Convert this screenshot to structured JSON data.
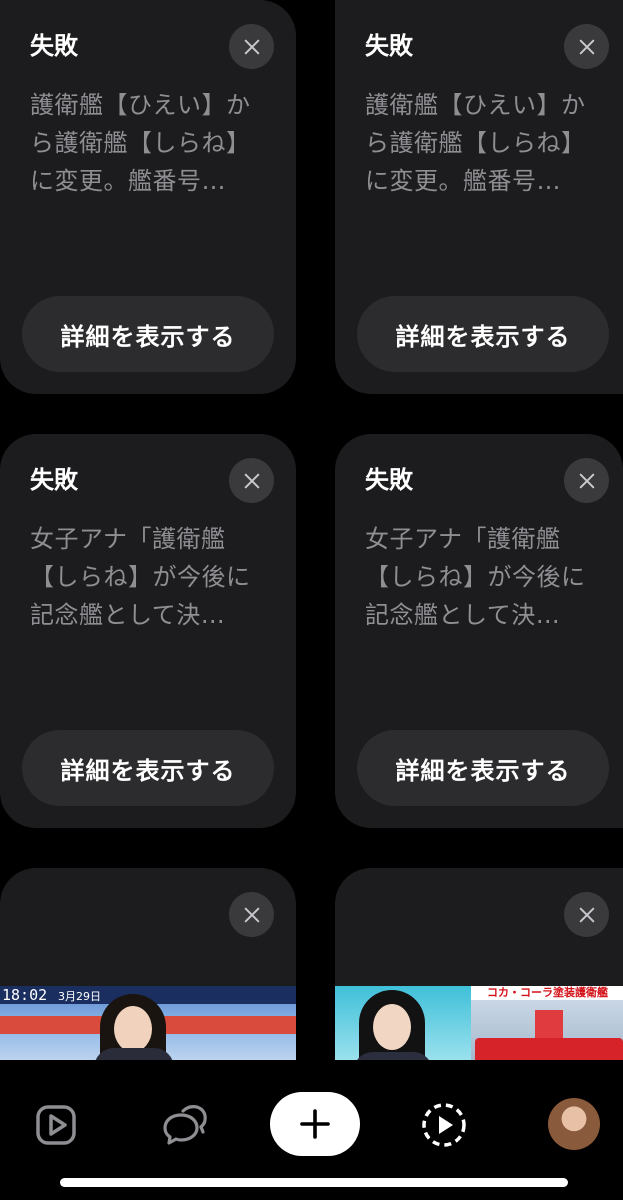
{
  "cards": [
    {
      "status": "失敗",
      "snippet": "護衛艦【ひえい】から護衛艦【しらね】に変更。艦番号…",
      "button": "詳細を表示する"
    },
    {
      "status": "失敗",
      "snippet": "護衛艦【ひえい】から護衛艦【しらね】に変更。艦番号…",
      "button": "詳細を表示する"
    },
    {
      "status": "失敗",
      "snippet": "女子アナ「護衛艦【しらね】が今後に記念艦として決…",
      "button": "詳細を表示する"
    },
    {
      "status": "失敗",
      "snippet": "女子アナ「護衛艦【しらね】が今後に記念艦として決…",
      "button": "詳細を表示する"
    }
  ],
  "thumbnails": [
    {
      "time": "18:02",
      "date": "3月29日"
    },
    {
      "caption": "コカ・コーラ塗装護衛艦"
    }
  ],
  "tabbar": {
    "items": [
      "home-icon",
      "chat-icon",
      "plus-icon",
      "video-icon",
      "avatar"
    ]
  },
  "colors": {
    "card_bg": "#1c1c1e",
    "snippet": "#8e8e93",
    "button_bg": "#2c2c2e"
  }
}
